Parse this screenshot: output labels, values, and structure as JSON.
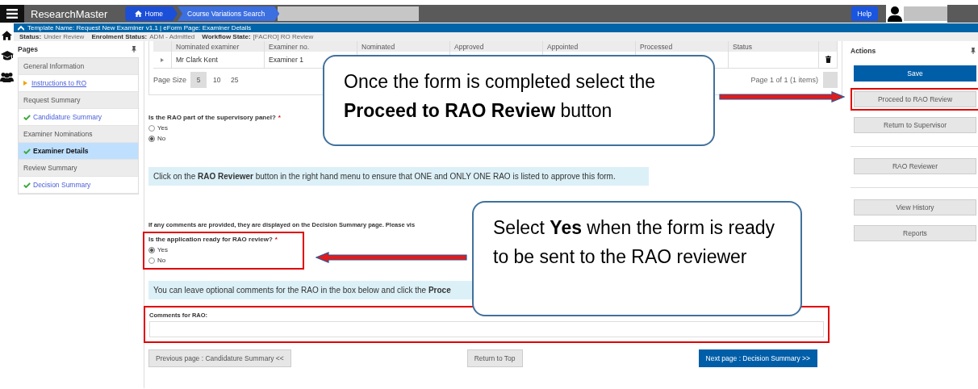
{
  "app": {
    "title": "ResearchMaster"
  },
  "breadcrumbs": [
    {
      "label": "Home",
      "kind": "home"
    },
    {
      "label": "Course Variations Search",
      "kind": "page"
    }
  ],
  "help_button": "Help",
  "template_bar": "Template Name: Request New Examiner v1.1 | eForm Page: Examiner Details",
  "status_items": [
    {
      "label": "Status:",
      "value": "Under Review"
    },
    {
      "label": "Enrolment Status:",
      "value": "ADM - Admitted"
    },
    {
      "label": "Workflow State:",
      "value": "[FACRO] RO Review"
    }
  ],
  "sidebar": {
    "title": "Pages",
    "items": [
      {
        "label": "General Information",
        "kind": "group"
      },
      {
        "label": "Instructions to RO",
        "kind": "page",
        "checked": false,
        "selected": false
      },
      {
        "label": "Request Summary",
        "kind": "group"
      },
      {
        "label": "Candidature Summary",
        "kind": "page",
        "checked": true,
        "selected": false
      },
      {
        "label": "Examiner Nominations",
        "kind": "group"
      },
      {
        "label": "Examiner Details",
        "kind": "page",
        "checked": true,
        "selected": true
      },
      {
        "label": "Review Summary",
        "kind": "group"
      },
      {
        "label": "Decision Summary",
        "kind": "page",
        "checked": true,
        "selected": false
      }
    ]
  },
  "table": {
    "columns": [
      "Nominated examiner",
      "Examiner no.",
      "Nominated",
      "Approved",
      "Appointed",
      "Processed",
      "Status"
    ],
    "rows": [
      {
        "cells": [
          "Mr Clark Kent",
          "Examiner 1"
        ]
      }
    ],
    "page_size_label": "Page Size",
    "page_sizes": [
      {
        "label": "5",
        "selected": true
      },
      {
        "label": "10",
        "selected": false
      },
      {
        "label": "25",
        "selected": false
      }
    ],
    "pager": "Page 1 of 1 (1 items)"
  },
  "question_1": {
    "label": "Is the RAO part of the supervisory panel?",
    "required_mark": "*",
    "highlighted": false,
    "options": [
      {
        "label": "Yes",
        "selected": false
      },
      {
        "label": "No",
        "selected": true
      }
    ]
  },
  "note_1": "Click on the **RAO Reviewer** button in the right hand menu to ensure that ONE and ONLY ONE RAO is listed to approve this form.",
  "comments_hint": "If any comments are provided, they are displayed on the Decision Summary page. Please vis",
  "question_2": {
    "label": "Is the application ready for RAO review?",
    "required_mark": "*",
    "highlighted": true,
    "options": [
      {
        "label": "Yes",
        "selected": true
      },
      {
        "label": "No",
        "selected": false
      }
    ]
  },
  "note_2": "You can leave optional comments for the RAO in the box below and click the **Proce**",
  "comments": {
    "label": "Comments for RAO:",
    "highlighted": true
  },
  "nav_buttons": [
    {
      "label": "Previous page : Candidature Summary <<",
      "kind": "secondary"
    },
    {
      "label": "Return to Top",
      "kind": "secondary"
    },
    {
      "label": "Next page : Decision Summary >>",
      "kind": "primary"
    }
  ],
  "actions": {
    "title": "Actions",
    "groups": [
      [
        {
          "label": "Save",
          "kind": "primary",
          "highlighted": false
        },
        {
          "label": "Proceed to RAO Review",
          "kind": "secondary",
          "highlighted": true
        },
        {
          "label": "Return to Supervisor",
          "kind": "secondary",
          "highlighted": false
        }
      ],
      [
        {
          "label": "RAO Reviewer",
          "kind": "secondary",
          "highlighted": false
        }
      ],
      [
        {
          "label": "View History",
          "kind": "secondary",
          "highlighted": false
        },
        {
          "label": "Reports",
          "kind": "secondary",
          "highlighted": false
        }
      ]
    ]
  },
  "callouts": [
    {
      "text": "Once the form is completed select the **Proceed to RAO Review** button"
    },
    {
      "text": "Select **Yes** when the form is ready to be sent to the RAO reviewer"
    }
  ]
}
